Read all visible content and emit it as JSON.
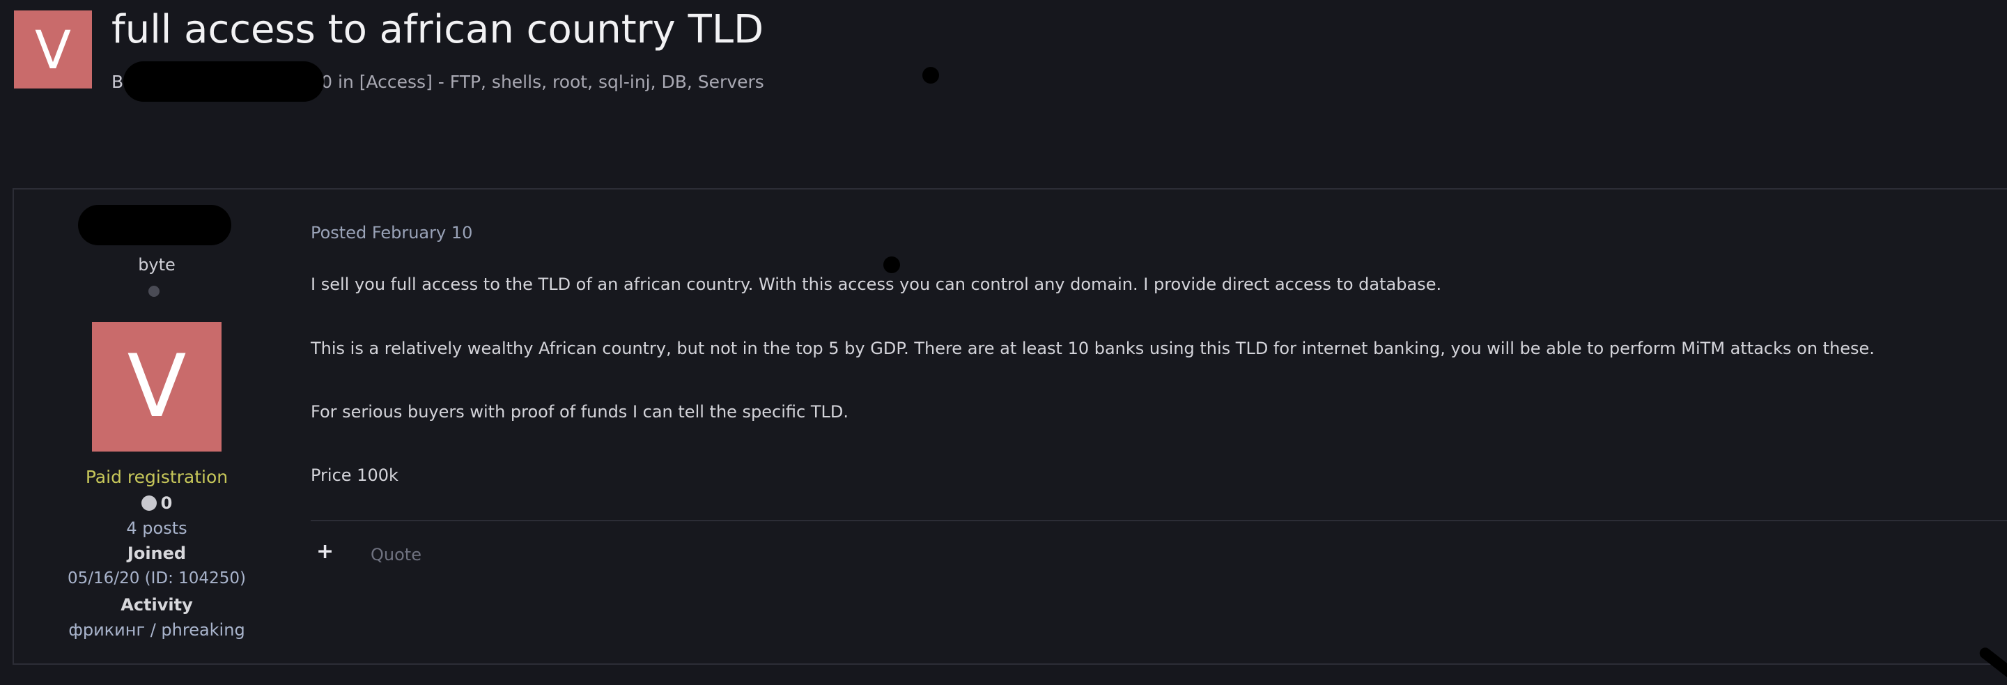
{
  "topic": {
    "avatar_letter": "V",
    "title": "full access to african country TLD",
    "byline_prefix": "B",
    "byline_suffix": "0 in [Access] - FTP, shells, root, sql-inj, DB, Servers"
  },
  "author": {
    "rank": "byte",
    "avatar_letter": "V",
    "group": "Paid registration",
    "reputation": "0",
    "posts": "4 posts",
    "joined_label": "Joined",
    "joined_value": "05/16/20 (ID: 104250)",
    "activity_label": "Activity",
    "activity_value": "фрикинг / phreaking"
  },
  "post": {
    "date": "Posted February 10",
    "paragraphs": [
      "I sell you full access to the TLD of an african country. With this access you can control any domain. I provide direct access to database.",
      "This is a relatively wealthy African country, but not in the top 5 by GDP. There are at least 10 banks using this TLD for internet banking, you will be able to perform MiTM attacks on these.",
      "For serious buyers with proof of funds I can tell the specific TLD.",
      "Price 100k"
    ],
    "actions": {
      "plus_label": "+",
      "quote_label": "Quote"
    }
  },
  "colors": {
    "background": "#16171d",
    "avatar": "#c96b6b",
    "group_text": "#c7c75a",
    "link_text": "#a9b4cc"
  },
  "icons": {
    "reputation": "reputation-dot-icon",
    "online_status": "online-status-icon",
    "plus": "plus-icon"
  }
}
